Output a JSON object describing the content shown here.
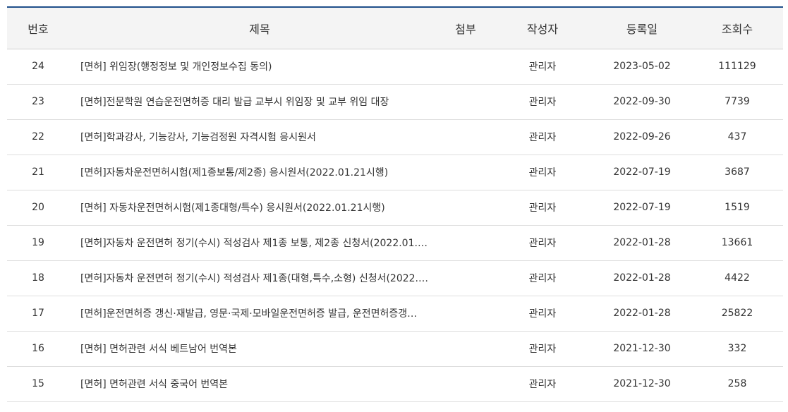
{
  "header": {
    "num": "번호",
    "title": "제목",
    "attachment": "첨부",
    "author": "작성자",
    "date": "등록일",
    "views": "조회수"
  },
  "rows": [
    {
      "num": "24",
      "title": "[면허] 위임장(행정정보 및 개인정보수집 동의)",
      "author": "관리자",
      "date": "2023-05-02",
      "views": "111129"
    },
    {
      "num": "23",
      "title": "[면허]전문학원 연습운전면허증 대리 발급 교부시 위임장 및 교부 위임 대장",
      "author": "관리자",
      "date": "2022-09-30",
      "views": "7739"
    },
    {
      "num": "22",
      "title": "[면허]학과강사, 기능강사, 기능검정원 자격시험 응시원서",
      "author": "관리자",
      "date": "2022-09-26",
      "views": "437"
    },
    {
      "num": "21",
      "title": "[면허]자동차운전면허시험(제1종보통/제2종) 응시원서(2022.01.21시행)",
      "author": "관리자",
      "date": "2022-07-19",
      "views": "3687"
    },
    {
      "num": "20",
      "title": "[면허] 자동차운전면허시험(제1종대형/특수) 응시원서(2022.01.21시행)",
      "author": "관리자",
      "date": "2022-07-19",
      "views": "1519"
    },
    {
      "num": "19",
      "title": "[면허]자동차 운전면허 정기(수시) 적성검사 제1종 보통, 제2종 신청서(2022.01.…",
      "author": "관리자",
      "date": "2022-01-28",
      "views": "13661"
    },
    {
      "num": "18",
      "title": "[면허]자동차 운전면허 정기(수시) 적성검사 제1종(대형,특수,소형) 신청서(2022.…",
      "author": "관리자",
      "date": "2022-01-28",
      "views": "4422"
    },
    {
      "num": "17",
      "title": "[면허]운전면허증 갱신·재발급, 영문·국제·모바일운전면허증 발급, 운전면허증갱…",
      "author": "관리자",
      "date": "2022-01-28",
      "views": "25822"
    },
    {
      "num": "16",
      "title": "[면허] 면허관련 서식 베트남어 번역본",
      "author": "관리자",
      "date": "2021-12-30",
      "views": "332"
    },
    {
      "num": "15",
      "title": "[면허] 면허관련 서식 중국어 번역본",
      "author": "관리자",
      "date": "2021-12-30",
      "views": "258"
    }
  ]
}
